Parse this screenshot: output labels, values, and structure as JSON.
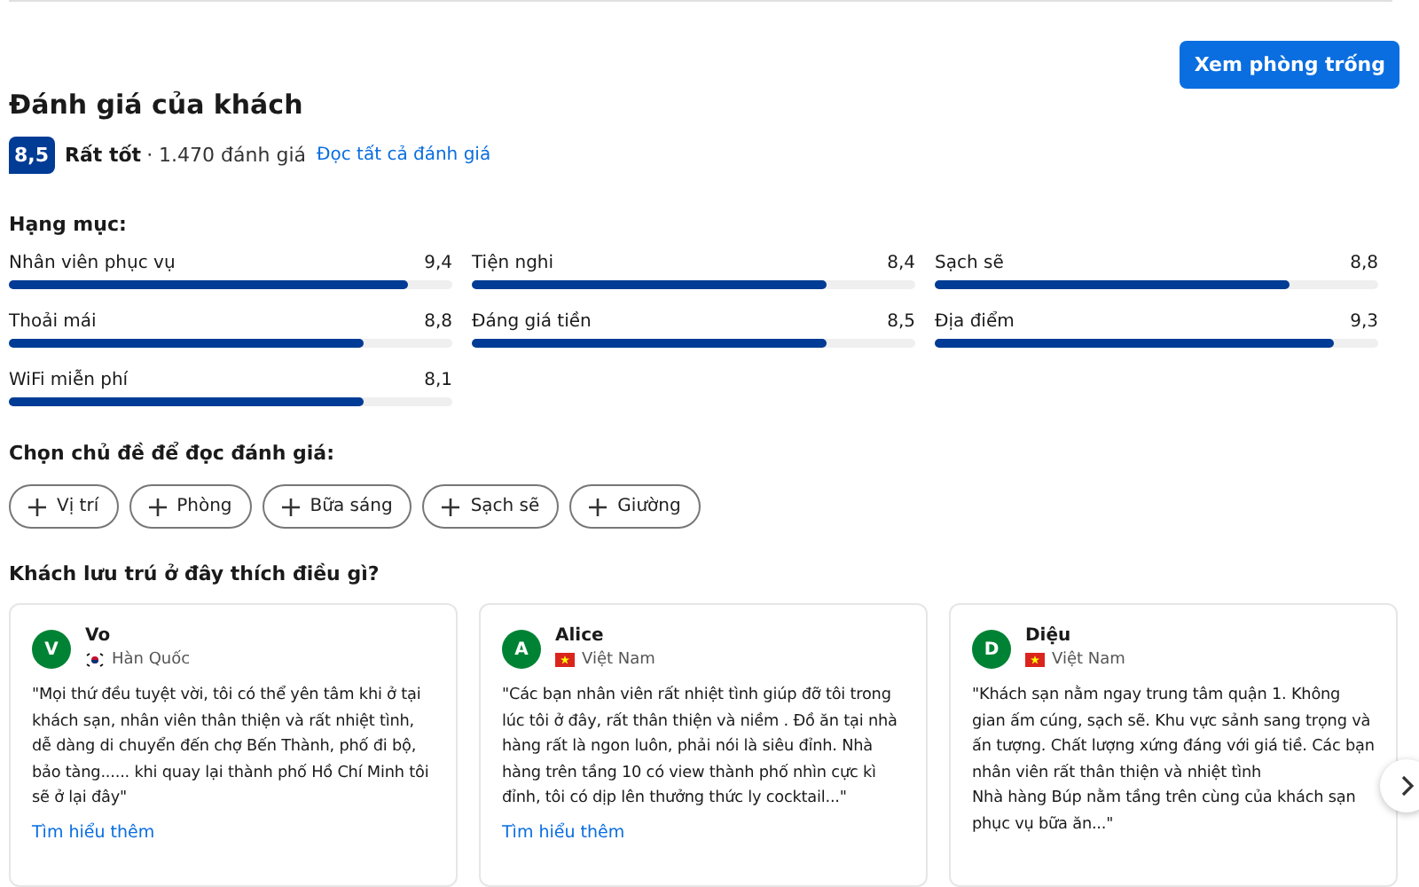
{
  "header": {
    "button": "Xem phòng trống"
  },
  "title": "Đánh giá của khách",
  "summary": {
    "score": "8,5",
    "rating": "Rất tốt",
    "count": "· 1.470 đánh giá",
    "link": "Đọc tất cả đánh giá"
  },
  "categories_title": "Hạng mục:",
  "categories": [
    {
      "name": "Nhân viên phục vụ",
      "score": "9,4",
      "level": 0.9
    },
    {
      "name": "Tiện nghi",
      "score": "8,4",
      "level": 0.8
    },
    {
      "name": "Sạch sẽ",
      "score": "8,8",
      "level": 0.8
    },
    {
      "name": "Thoải mái",
      "score": "8,8",
      "level": 0.8
    },
    {
      "name": "Đáng giá tiền",
      "score": "8,5",
      "level": 0.8
    },
    {
      "name": "Địa điểm",
      "score": "9,3",
      "level": 0.9
    },
    {
      "name": "WiFi miễn phí",
      "score": "8,1",
      "level": 0.8
    }
  ],
  "topics_title": "Chọn chủ đề để đọc đánh giá:",
  "topics": [
    {
      "label": "Vị trí"
    },
    {
      "label": "Phòng"
    },
    {
      "label": "Bữa sáng"
    },
    {
      "label": "Sạch sẽ"
    },
    {
      "label": "Giường"
    }
  ],
  "reviews_title": "Khách lưu trú ở đây thích điều gì?",
  "reviews": [
    {
      "initial": "V",
      "name": "Vo",
      "flag": {
        "kind": "kr"
      },
      "country": "Hàn Quốc",
      "text": "\"Mọi thứ đều tuyệt vời, tôi có thể yên tâm khi ở tại khách sạn, nhân viên thân thiện và rất nhiệt tình, dễ dàng di chuyển đến chợ Bến Thành, phố đi bộ, bảo tàng...... khi quay lại thành phố Hồ Chí Minh tôi sẽ ở lại đây\"",
      "more": "Tìm hiểu thêm"
    },
    {
      "initial": "A",
      "name": "Alice",
      "flag": {
        "kind": "vn"
      },
      "country": "Việt Nam",
      "text": "\"Các bạn nhân viên rất nhiệt tình giúp đỡ tôi trong lúc tôi ở đây, rất thân thiện và niềm . Đồ ăn tại nhà hàng rất là ngon luôn, phải nói là siêu đỉnh. Nhà hàng trên tầng 10 có view thành phố nhìn cực kì đỉnh, tôi có dịp lên thưởng thức ly cocktail...\"",
      "more": "Tìm hiểu thêm"
    },
    {
      "initial": "D",
      "name": "Diệu",
      "flag": {
        "kind": "vn"
      },
      "country": "Việt Nam",
      "text": "\"Khách sạn nằm ngay trung tâm quận 1. Không gian ấm cúng, sạch sẽ. Khu vực sảnh sang trọng và ấn tượng. Chất lượng xứng đáng với giá tiề. Các bạn nhân viên rất thân thiện và nhiệt tình\nNhà hàng Búp nằm tầng trên cùng của khách sạn phục vụ bữa ăn...\""
    }
  ]
}
